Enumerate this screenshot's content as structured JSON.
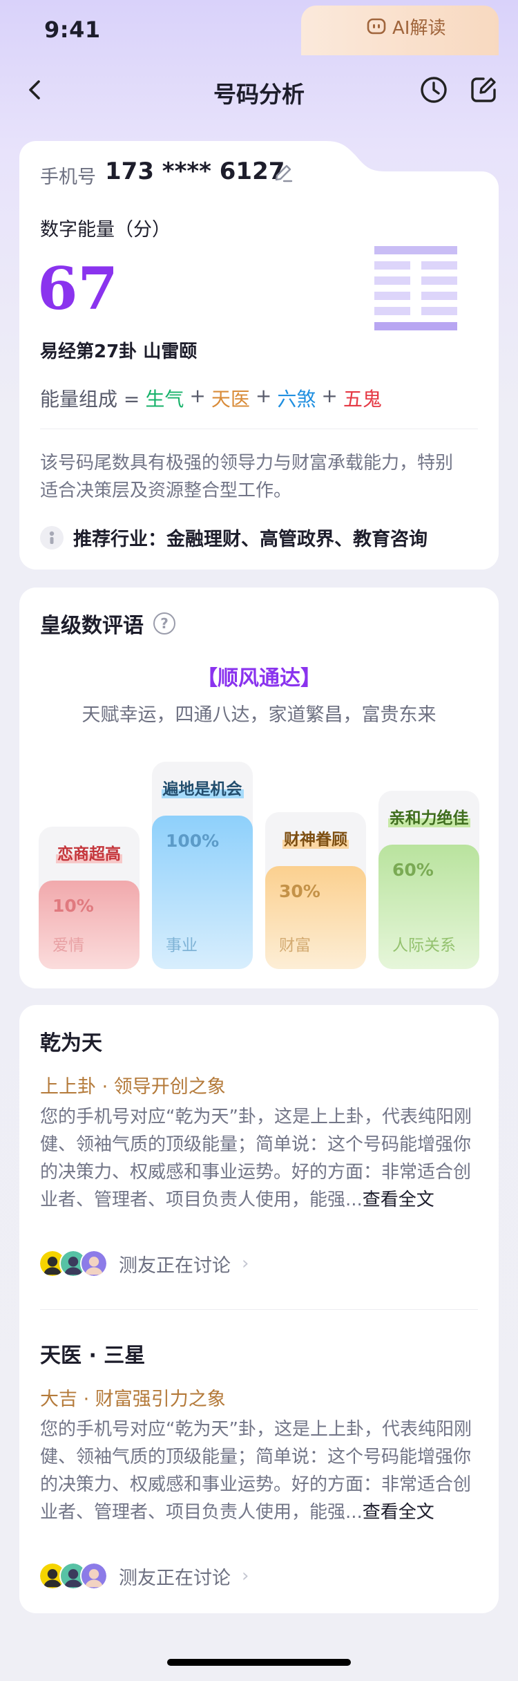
{
  "status": {
    "time": "9:41"
  },
  "nav": {
    "title": "号码分析"
  },
  "ai": {
    "label": "AI解读"
  },
  "phone": {
    "label": "手机号",
    "number": "173 **** 6127"
  },
  "energy": {
    "label": "数字能量（分）",
    "score": "67",
    "gua": "易经第27卦 山雷颐",
    "compose_label": "能量组成 =",
    "compose": [
      {
        "text": "生气",
        "color": "#17b26a"
      },
      {
        "text": "天医",
        "color": "#d98c3a"
      },
      {
        "text": "六煞",
        "color": "#1f8fe0"
      },
      {
        "text": "五鬼",
        "color": "#e53945"
      }
    ],
    "plus": "+"
  },
  "summary": {
    "desc": "该号码尾数具有极强的领导力与财富承载能力，特别适合决策层及资源整合型工作。",
    "rec_label": "推荐行业：",
    "rec_value": "金融理财、高管政界、教育咨询"
  },
  "grade": {
    "title": "皇级数评语",
    "slogan": "【顺风通达】",
    "slogan_sub": "天赋幸运，四通八达，家道繁昌，富贵东来",
    "bars": [
      {
        "tag": "恋商超高",
        "pct": "10%",
        "cat": "爱情",
        "value": 10
      },
      {
        "tag": "遍地是机会",
        "pct": "100%",
        "cat": "事业",
        "value": 100
      },
      {
        "tag": "财神眷顾",
        "pct": "30%",
        "cat": "财富",
        "value": 30
      },
      {
        "tag": "亲和力绝佳",
        "pct": "60%",
        "cat": "人际关系",
        "value": 60
      }
    ]
  },
  "items": [
    {
      "title": "乾为天",
      "sub": "上上卦 · 领导开创之象",
      "body": "您的手机号对应“乾为天”卦，这是上上卦，代表纯阳刚健、领袖气质的顶级能量；简单说：这个号码能增强你的决策力、权威感和事业运势。好的方面：非常适合创业者、管理者、项目负责人使用，能强...",
      "more": "查看全文",
      "discuss": "测友正在讨论"
    },
    {
      "title": "天医 · 三星",
      "sub": "大吉 · 财富强引力之象",
      "body": "您的手机号对应“乾为天”卦，这是上上卦，代表纯阳刚健、领袖气质的顶级能量；简单说：这个号码能增强你的决策力、权威感和事业运势。好的方面：非常适合创业者、管理者、项目负责人使用，能强...",
      "more": "查看全文",
      "discuss": "测友正在讨论"
    }
  ]
}
